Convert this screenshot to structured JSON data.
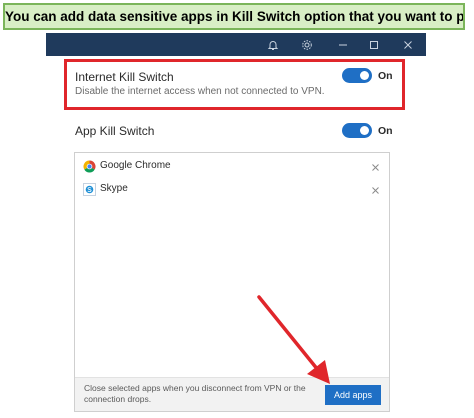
{
  "banner": {
    "text": "You can add data sensitive apps in Kill Switch option that you want to protect"
  },
  "titlebar": {
    "icons": [
      "bell-icon",
      "gear-icon",
      "minimize-icon",
      "maximize-icon",
      "close-icon"
    ]
  },
  "internet_kill_switch": {
    "title": "Internet Kill Switch",
    "description": "Disable the internet access when not connected to VPN.",
    "state_label": "On",
    "enabled": true
  },
  "app_kill_switch": {
    "title": "App Kill Switch",
    "state_label": "On",
    "enabled": true
  },
  "apps": [
    {
      "name": "Google Chrome",
      "icon": "chrome-icon"
    },
    {
      "name": "Skype",
      "icon": "skype-icon"
    }
  ],
  "footer": {
    "text": "Close selected apps when you disconnect from VPN or the connection drops.",
    "add_button": "Add apps"
  },
  "colors": {
    "banner_bg": "#d8eec5",
    "banner_border": "#7bb55a",
    "titlebar": "#1f3a5c",
    "accent": "#1f6fc5",
    "highlight": "#e0262b"
  }
}
